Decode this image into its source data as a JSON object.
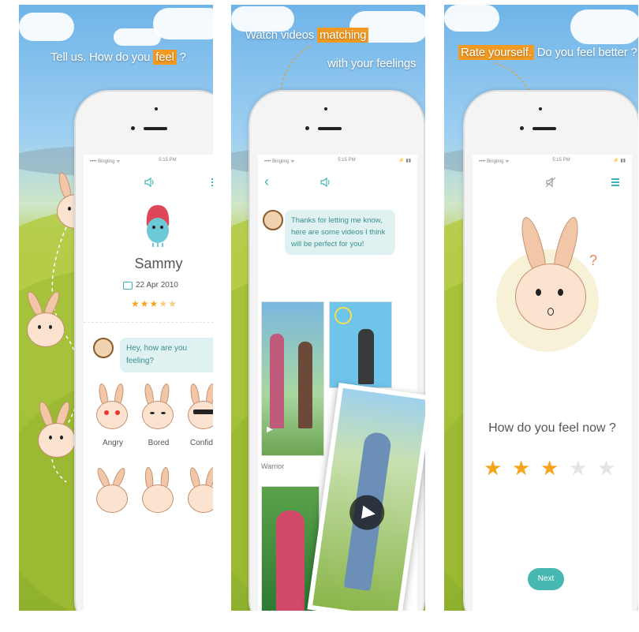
{
  "panel1": {
    "caption_prefix": "Tell us. How do you",
    "caption_highlight": "feel",
    "caption_suffix": "?",
    "status_left": "•••• Bingling ᯤ",
    "status_time": "5:15 PM",
    "status_right": "⚡ ▮▮",
    "profile_name": "Sammy",
    "profile_date": "22 Apr 2010",
    "profile_rating": 3,
    "chat_message": "Hey, how are you feeling?",
    "emotions": [
      "Angry",
      "Bored",
      "Confiden"
    ]
  },
  "panel2": {
    "caption_line1_prefix": "Watch videos",
    "caption_line1_highlight": "matching",
    "caption_line2": "with your feelings",
    "status_left": "•••• Bingling ᯤ",
    "status_time": "5:15 PM",
    "status_right": "⚡ ▮▮",
    "bot_message": "Thanks for letting me know, here are some videos I think will be perfect for you!",
    "video_label": "Warrior"
  },
  "panel3": {
    "caption_highlight": "Rate yourself.",
    "caption_suffix": "Do you feel better ?",
    "status_left": "•••• Bingling ᯤ",
    "status_time": "5:15 PM",
    "status_right": "⚡ ▮▮",
    "question": "How do you feel now ?",
    "rating": 3,
    "rating_max": 5,
    "next_label": "Next"
  },
  "colors": {
    "accent_teal": "#3fb4b4",
    "highlight_orange": "#f29a22",
    "star_on": "#f5a51c",
    "star_off": "#e4e4e4"
  }
}
